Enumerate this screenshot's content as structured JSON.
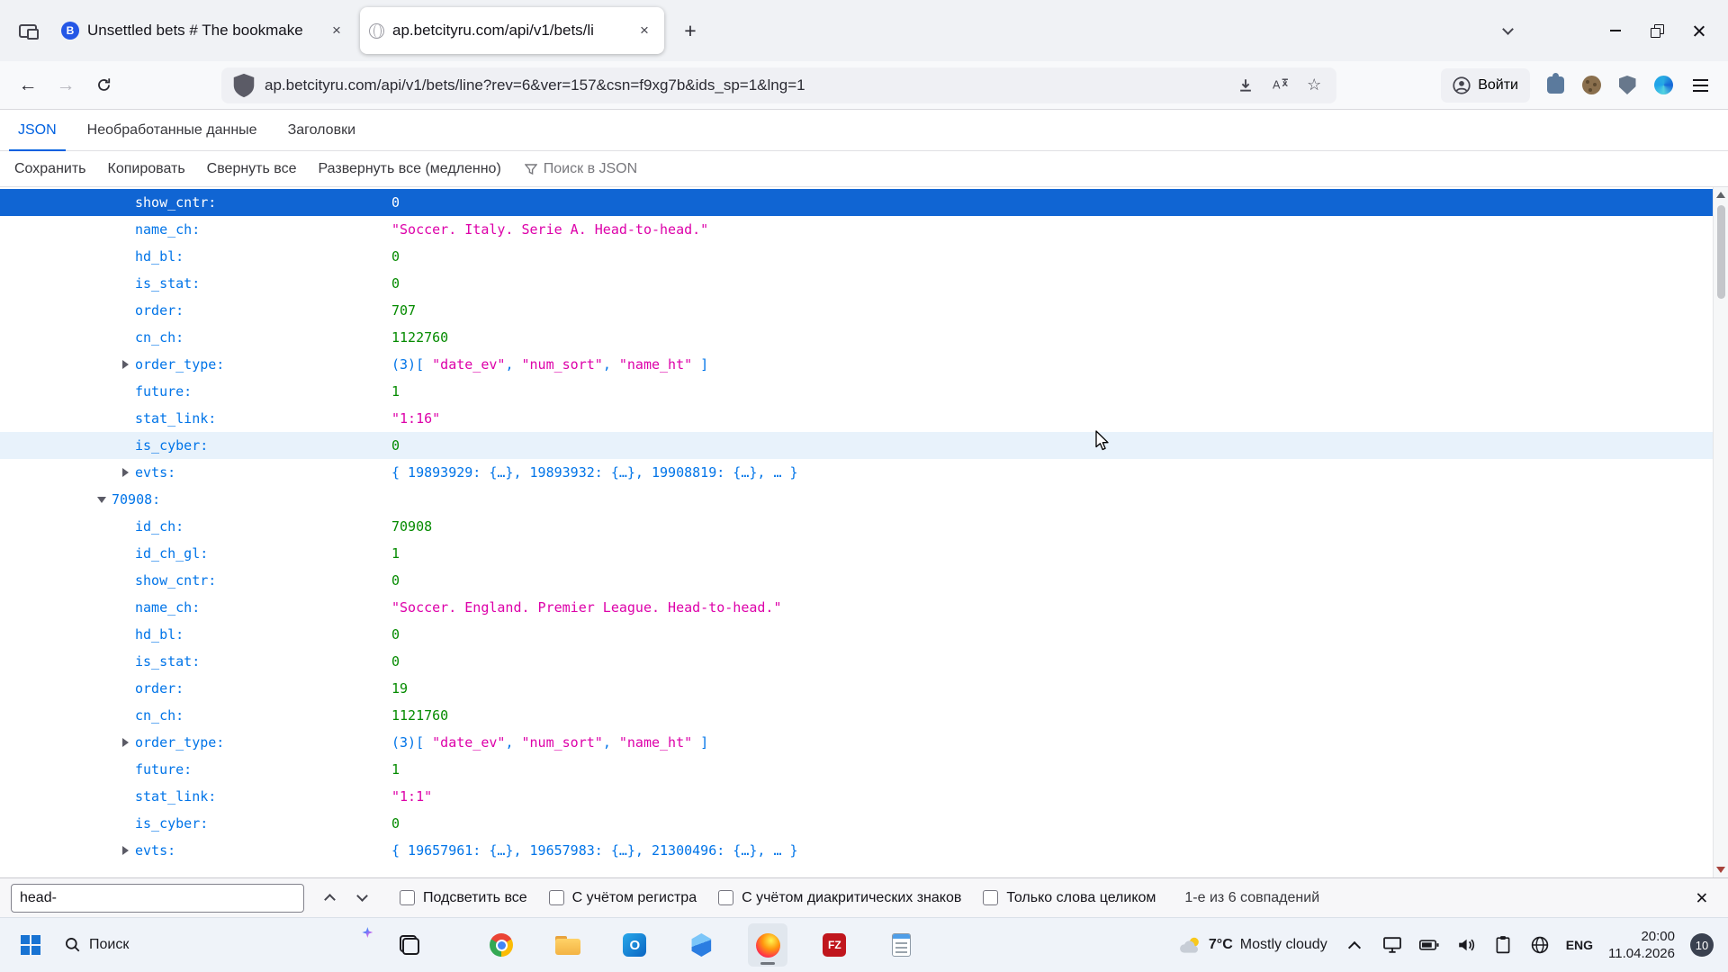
{
  "browser": {
    "tabs": [
      {
        "title": "Unsettled bets # The bookmake",
        "favicon_letter": "B"
      },
      {
        "title": "ap.betcityru.com/api/v1/bets/li",
        "active": true
      }
    ],
    "url": "ap.betcityru.com/api/v1/bets/line?rev=6&ver=157&csn=f9xg7b&ids_sp=1&lng=1",
    "signin_label": "Войти"
  },
  "glyphs": {
    "back": "←",
    "forward": "→",
    "new_tab": "+",
    "close": "×",
    "star": "☆"
  },
  "viewer": {
    "tabs": [
      {
        "label": "JSON",
        "active": true
      },
      {
        "label": "Необработанные данные"
      },
      {
        "label": "Заголовки"
      }
    ],
    "toolbar": {
      "save": "Сохранить",
      "copy": "Копировать",
      "collapse_all": "Свернуть все",
      "expand_all": "Развернуть все (медленно)",
      "search_placeholder": "Поиск в JSON"
    }
  },
  "json_rows": [
    {
      "level": 2,
      "key": "show_cntr",
      "state": "selected",
      "segs": [
        {
          "c": "num",
          "v": "0"
        }
      ]
    },
    {
      "level": 2,
      "key": "name_ch",
      "segs": [
        {
          "c": "str",
          "v": "\"Soccer. Italy. Serie A. Head-to-head.\""
        }
      ]
    },
    {
      "level": 2,
      "key": "hd_bl",
      "segs": [
        {
          "c": "num",
          "v": "0"
        }
      ]
    },
    {
      "level": 2,
      "key": "is_stat",
      "segs": [
        {
          "c": "num",
          "v": "0"
        }
      ]
    },
    {
      "level": 2,
      "key": "order",
      "segs": [
        {
          "c": "num",
          "v": "707"
        }
      ]
    },
    {
      "level": 2,
      "key": "cn_ch",
      "segs": [
        {
          "c": "num",
          "v": "1122760"
        }
      ]
    },
    {
      "level": 2,
      "key": "order_type",
      "twisty": "collapsed",
      "segs": [
        {
          "c": "prev",
          "v": "(3)[ "
        },
        {
          "c": "str",
          "v": "\"date_ev\""
        },
        {
          "c": "prev",
          "v": ", "
        },
        {
          "c": "str",
          "v": "\"num_sort\""
        },
        {
          "c": "prev",
          "v": ", "
        },
        {
          "c": "str",
          "v": "\"name_ht\""
        },
        {
          "c": "prev",
          "v": " ]"
        }
      ]
    },
    {
      "level": 2,
      "key": "future",
      "segs": [
        {
          "c": "num",
          "v": "1"
        }
      ]
    },
    {
      "level": 2,
      "key": "stat_link",
      "segs": [
        {
          "c": "str",
          "v": "\"1:16\""
        }
      ]
    },
    {
      "level": 2,
      "key": "is_cyber",
      "state": "hover",
      "segs": [
        {
          "c": "num",
          "v": "0"
        }
      ]
    },
    {
      "level": 2,
      "key": "evts",
      "twisty": "collapsed",
      "segs": [
        {
          "c": "prev",
          "v": "{ 19893929: {…}, 19893932: {…}, 19908819: {…}, … }"
        }
      ]
    },
    {
      "level": 1,
      "key": "70908",
      "twisty": "expanded",
      "segs": []
    },
    {
      "level": 2,
      "key": "id_ch",
      "segs": [
        {
          "c": "num",
          "v": "70908"
        }
      ]
    },
    {
      "level": 2,
      "key": "id_ch_gl",
      "segs": [
        {
          "c": "num",
          "v": "1"
        }
      ]
    },
    {
      "level": 2,
      "key": "show_cntr",
      "segs": [
        {
          "c": "num",
          "v": "0"
        }
      ]
    },
    {
      "level": 2,
      "key": "name_ch",
      "segs": [
        {
          "c": "str",
          "v": "\"Soccer. England. Premier League. Head-to-head.\""
        }
      ]
    },
    {
      "level": 2,
      "key": "hd_bl",
      "segs": [
        {
          "c": "num",
          "v": "0"
        }
      ]
    },
    {
      "level": 2,
      "key": "is_stat",
      "segs": [
        {
          "c": "num",
          "v": "0"
        }
      ]
    },
    {
      "level": 2,
      "key": "order",
      "segs": [
        {
          "c": "num",
          "v": "19"
        }
      ]
    },
    {
      "level": 2,
      "key": "cn_ch",
      "segs": [
        {
          "c": "num",
          "v": "1121760"
        }
      ]
    },
    {
      "level": 2,
      "key": "order_type",
      "twisty": "collapsed",
      "segs": [
        {
          "c": "prev",
          "v": "(3)[ "
        },
        {
          "c": "str",
          "v": "\"date_ev\""
        },
        {
          "c": "prev",
          "v": ", "
        },
        {
          "c": "str",
          "v": "\"num_sort\""
        },
        {
          "c": "prev",
          "v": ", "
        },
        {
          "c": "str",
          "v": "\"name_ht\""
        },
        {
          "c": "prev",
          "v": " ]"
        }
      ]
    },
    {
      "level": 2,
      "key": "future",
      "segs": [
        {
          "c": "num",
          "v": "1"
        }
      ]
    },
    {
      "level": 2,
      "key": "stat_link",
      "segs": [
        {
          "c": "str",
          "v": "\"1:1\""
        }
      ]
    },
    {
      "level": 2,
      "key": "is_cyber",
      "segs": [
        {
          "c": "num",
          "v": "0"
        }
      ]
    },
    {
      "level": 2,
      "key": "evts",
      "twisty": "collapsed",
      "segs": [
        {
          "c": "prev",
          "v": "{ 19657961: {…}, 19657983: {…}, 21300496: {…}, … }"
        }
      ]
    }
  ],
  "findbar": {
    "query": "head-",
    "highlight_all": "Подсветить все",
    "match_case": "С учётом регистра",
    "match_diacritics": "С учётом диакритических знаков",
    "whole_words": "Только слова целиком",
    "status": "1-е из 6 совпадений"
  },
  "taskbar": {
    "search": "Поиск",
    "weather_temp": "7°C",
    "weather_desc": "Mostly cloudy",
    "lang": "ENG",
    "time": "20:00",
    "date": "11.04.2026",
    "notifications": "10",
    "outlook_letter": "O",
    "filezilla_letters": "FZ"
  },
  "colors": {
    "key": "#0074e8",
    "number": "#058b00",
    "string": "#dd00a9",
    "selection_bg": "#1065d3"
  }
}
